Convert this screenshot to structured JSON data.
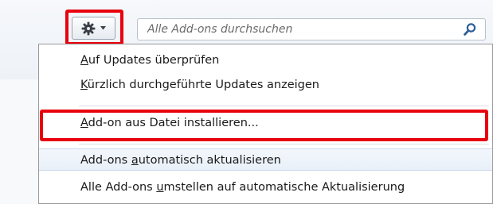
{
  "toolbar": {
    "search_placeholder": "Alle Add-ons durchsuchen"
  },
  "menu": {
    "items": [
      {
        "before": "",
        "key": "A",
        "after": "uf Updates überprüfen"
      },
      {
        "before": "",
        "key": "K",
        "after": "ürzlich durchgeführte Updates anzeigen"
      },
      {
        "before": "",
        "key": "A",
        "after": "dd-on aus Datei installieren..."
      },
      {
        "before": "Add-ons ",
        "key": "a",
        "after": "utomatisch aktualisieren"
      },
      {
        "before": "Alle Add-ons ",
        "key": "u",
        "after": "mstellen auf automatische Aktualisierung"
      }
    ]
  },
  "colors": {
    "highlight": "#e8000d",
    "hover_row": "#e9f0f8"
  }
}
